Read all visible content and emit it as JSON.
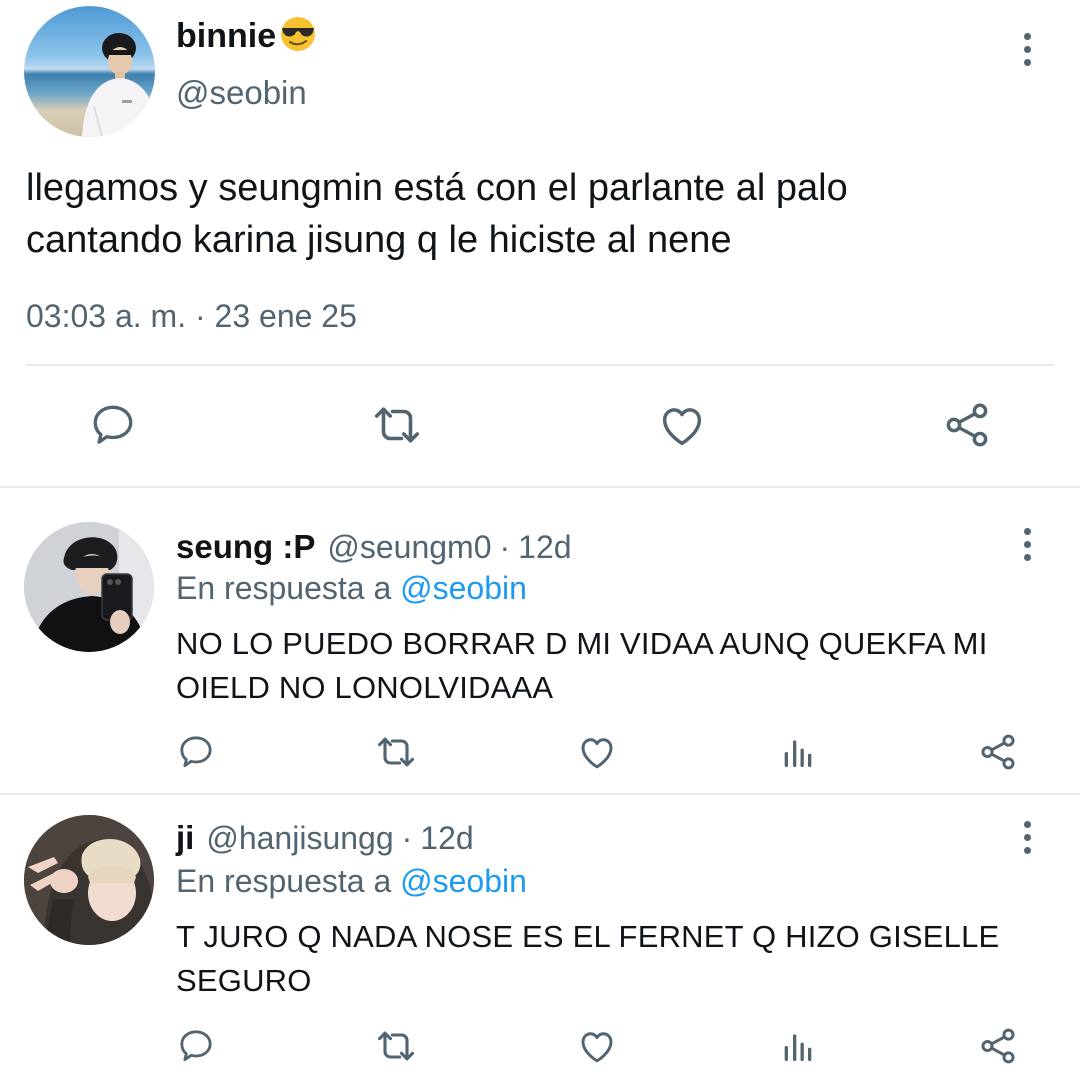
{
  "main_tweet": {
    "display_name": "binnie",
    "name_emoji": "smiling-face-with-sunglasses",
    "handle": "@seobin",
    "text_line1": "llegamos y seungmin está con el parlante al palo",
    "text_line2": "cantando karina jisung q le hiciste al nene",
    "timestamp": "03:03 a. m. · 23 ene 25",
    "actions": [
      "reply-icon",
      "retweet-icon",
      "like-icon",
      "share-icon"
    ]
  },
  "replies": [
    {
      "display_name": "seung :P",
      "handle": "@seungm0",
      "dot": "·",
      "time": "12d",
      "reply_prefix": "En respuesta a ",
      "reply_mention": "@seobin",
      "text_line1": "NO LO PUEDO BORRAR D MI VIDAA AUNQ QUEKFA MI",
      "text_line2": "OIELD NO LONOLVIDAAA",
      "actions": [
        "reply-icon",
        "retweet-icon",
        "like-icon",
        "views-icon",
        "share-icon"
      ]
    },
    {
      "display_name": "ji",
      "handle": "@hanjisungg",
      "dot": "·",
      "time": "12d",
      "reply_prefix": "En respuesta a ",
      "reply_mention": "@seobin",
      "text_line1": "T JURO Q NADA NOSE ES EL FERNET Q HIZO GISELLE",
      "text_line2": "SEGURO",
      "actions": [
        "reply-icon",
        "retweet-icon",
        "like-icon",
        "views-icon",
        "share-icon"
      ]
    }
  ],
  "colors": {
    "text_primary": "#0f1419",
    "text_secondary": "#536471",
    "link": "#1d9bf0",
    "icon": "#536471",
    "divider": "#e6e9eb"
  }
}
